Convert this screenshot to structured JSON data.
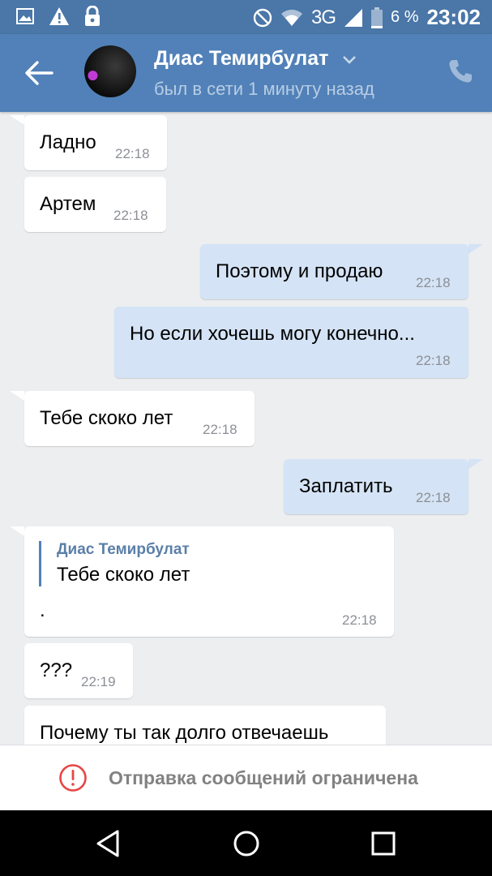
{
  "status_bar": {
    "network": "3G",
    "battery": "6 %",
    "time": "23:02",
    "icons": [
      "image-icon",
      "warning-icon",
      "lock-icon",
      "do-not-disturb-icon",
      "wifi-icon",
      "signal-icon",
      "battery-icon"
    ]
  },
  "header": {
    "name": "Диас Темирбулат",
    "status": "был в сети 1 минуту назад",
    "icons": [
      "back-arrow-icon",
      "chevron-down-icon",
      "phone-icon"
    ]
  },
  "messages": [
    {
      "dir": "in",
      "text": "Ладно",
      "time": "22:18"
    },
    {
      "dir": "in",
      "text": "Артем",
      "time": "22:18"
    },
    {
      "dir": "out",
      "text": "Поэтому и продаю",
      "time": "22:18"
    },
    {
      "dir": "out",
      "text": "Но если хочешь могу конечно...",
      "time": "22:18"
    },
    {
      "dir": "in",
      "text": "Тебе скоко лет",
      "time": "22:18"
    },
    {
      "dir": "out",
      "text": "Заплатить",
      "time": "22:18"
    },
    {
      "dir": "in",
      "reply_name": "Диас Темирбулат",
      "reply_text": "Тебе скоко лет",
      "text": ".",
      "time": "22:18"
    },
    {
      "dir": "in",
      "text": "???",
      "time": "22:19"
    },
    {
      "dir": "in",
      "text": "Почему ты так долго отвечаешь",
      "time": ""
    }
  ],
  "restriction": {
    "text": "Отправка сообщений ограничена",
    "icon": "warning-circle-icon",
    "color": "#e64646"
  },
  "colors": {
    "header": "#5181b8",
    "status_bar": "#4a76a8",
    "incoming": "#ffffff",
    "outgoing": "#d4e3f5",
    "background": "#edeef0"
  }
}
